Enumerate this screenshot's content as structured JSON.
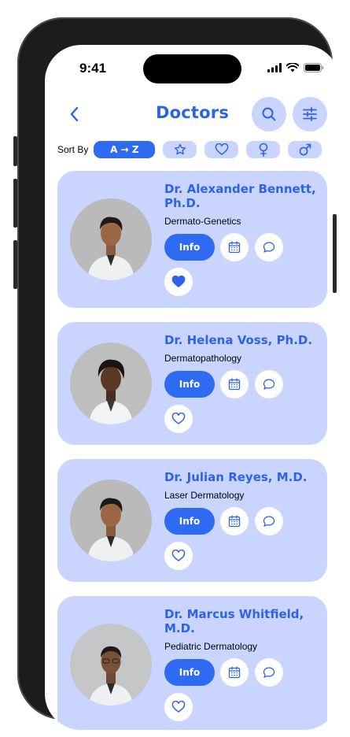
{
  "status": {
    "time": "9:41"
  },
  "header": {
    "title": "Doctors"
  },
  "sort": {
    "label": "Sort By",
    "options": [
      {
        "label": "A → Z",
        "active": true
      },
      {
        "icon": "star-icon"
      },
      {
        "icon": "heart-icon"
      },
      {
        "icon": "female-icon"
      },
      {
        "icon": "male-icon"
      }
    ]
  },
  "doctors": [
    {
      "name": "Dr. Alexander Bennett, Ph.D.",
      "specialty": "Dermato-Genetics",
      "info_label": "Info",
      "favorite": true
    },
    {
      "name": "Dr. Helena Voss, Ph.D.",
      "specialty": "Dermatopathology",
      "info_label": "Info",
      "favorite": false
    },
    {
      "name": "Dr. Julian Reyes, M.D.",
      "specialty": "Laser Dermatology",
      "info_label": "Info",
      "favorite": false
    },
    {
      "name": "Dr. Marcus Whitfield, M.D.",
      "specialty": "Pediatric Dermatology",
      "info_label": "Info",
      "favorite": false
    }
  ],
  "colors": {
    "accent": "#2e63e8",
    "card": "#c9d5ff",
    "button": "#2f6bf2"
  }
}
